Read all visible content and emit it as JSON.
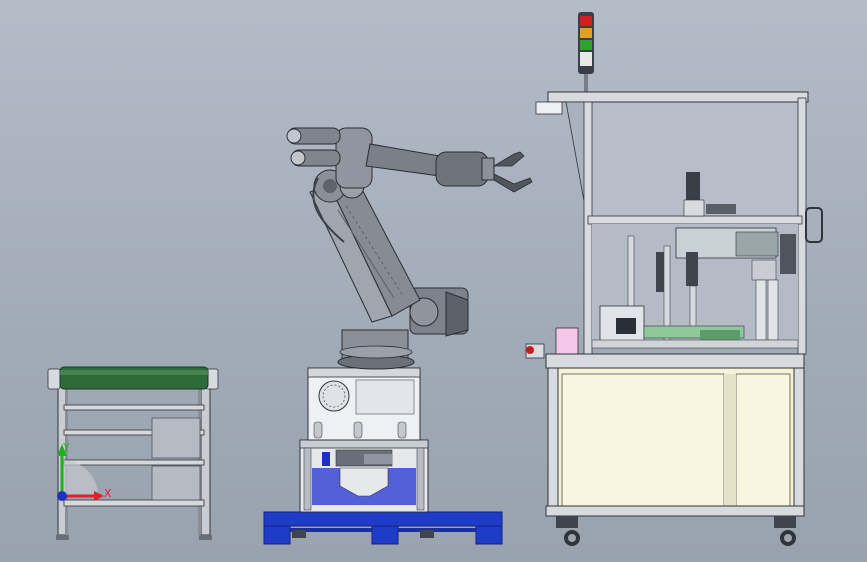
{
  "viewport": {
    "background_top": "#b4bcc8",
    "background_bottom": "#99a2af"
  },
  "triad": {
    "x_label": "X",
    "y_label": "Y",
    "x_color": "#e0202a",
    "y_color": "#22b022",
    "z_color": "#2030c0"
  },
  "components": {
    "conveyor": "roller-conveyor",
    "robot": "six-axis-robot-arm",
    "pedestal": "robot-pedestal",
    "pallet": "blue-pallet",
    "workcell": "enclosed-workcell",
    "signal_tower": "stack-light",
    "signal_colors": [
      "#d02020",
      "#e0a020",
      "#30a030",
      "#e8e8e8"
    ]
  }
}
